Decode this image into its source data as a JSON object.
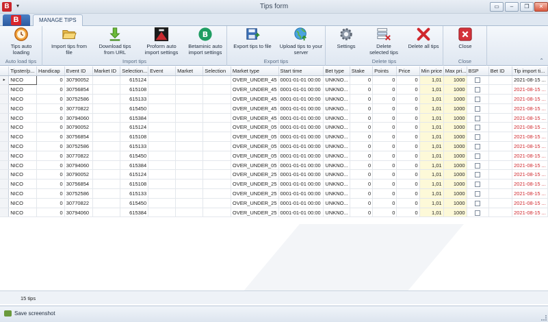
{
  "window": {
    "title": "Tips form",
    "app_badge": "B",
    "min_icon": "minimize-icon",
    "restore_icon": "restore-icon",
    "close_icon": "close-icon"
  },
  "ribbon": {
    "app_button_badge": "B",
    "tab": "MANAGE TIPS",
    "groups": [
      {
        "label": "Auto load tips",
        "buttons": [
          {
            "label": "Tips auto loading",
            "icon": "clock-icon"
          }
        ]
      },
      {
        "label": "Import tips",
        "buttons": [
          {
            "label": "Import tips from file",
            "icon": "folder-open-icon"
          },
          {
            "label": "Download tips from URL",
            "icon": "download-arrow-icon"
          },
          {
            "label": "Proform auto import settings",
            "icon": "proform-logo-icon"
          },
          {
            "label": "Betaminic auto import settings",
            "icon": "betaminic-logo-icon"
          }
        ]
      },
      {
        "label": "Export tips",
        "buttons": [
          {
            "label": "Export tips to file",
            "icon": "save-export-icon"
          },
          {
            "label": "Upload tips to your server",
            "icon": "globe-upload-icon"
          }
        ]
      },
      {
        "label": "Delete tips",
        "buttons": [
          {
            "label": "Settings",
            "icon": "gear-icon"
          },
          {
            "label": "Delete selected tips",
            "icon": "delete-selected-icon"
          },
          {
            "label": "Delete all tips",
            "icon": "red-x-icon"
          }
        ]
      },
      {
        "label": "Close",
        "buttons": [
          {
            "label": "Close",
            "icon": "close-red-icon"
          }
        ]
      }
    ]
  },
  "grid": {
    "columns": [
      "Tipster/p...",
      "Handicap",
      "Event ID",
      "Market ID",
      "Selection...",
      "Event",
      "Market",
      "Selection",
      "Market type",
      "Start time",
      "Bet type",
      "Stake",
      "Points",
      "Price",
      "Min price",
      "Max pri...",
      "BSP",
      "Bet ID",
      "Tip import ti..."
    ],
    "rows": [
      [
        "NICO",
        "0",
        "30790052",
        "",
        "615124",
        "",
        "",
        "",
        "OVER_UNDER_45",
        "0001-01-01 00:00",
        "UNKNO...",
        "0",
        "0",
        "0",
        "1,01",
        "1000",
        "",
        "",
        "2021-08-15 ..."
      ],
      [
        "NICO",
        "0",
        "30756854",
        "",
        "615108",
        "",
        "",
        "",
        "OVER_UNDER_45",
        "0001-01-01 00:00",
        "UNKNO...",
        "0",
        "0",
        "0",
        "1,01",
        "1000",
        "",
        "",
        "2021-08-15 ..."
      ],
      [
        "NICO",
        "0",
        "30752586",
        "",
        "615133",
        "",
        "",
        "",
        "OVER_UNDER_45",
        "0001-01-01 00:00",
        "UNKNO...",
        "0",
        "0",
        "0",
        "1,01",
        "1000",
        "",
        "",
        "2021-08-15 ..."
      ],
      [
        "NICO",
        "0",
        "30770822",
        "",
        "615450",
        "",
        "",
        "",
        "OVER_UNDER_45",
        "0001-01-01 00:00",
        "UNKNO...",
        "0",
        "0",
        "0",
        "1,01",
        "1000",
        "",
        "",
        "2021-08-15 ..."
      ],
      [
        "NICO",
        "0",
        "30794060",
        "",
        "615384",
        "",
        "",
        "",
        "OVER_UNDER_45",
        "0001-01-01 00:00",
        "UNKNO...",
        "0",
        "0",
        "0",
        "1,01",
        "1000",
        "",
        "",
        "2021-08-15 ..."
      ],
      [
        "NICO",
        "0",
        "30790052",
        "",
        "615124",
        "",
        "",
        "",
        "OVER_UNDER_05",
        "0001-01-01 00:00",
        "UNKNO...",
        "0",
        "0",
        "0",
        "1,01",
        "1000",
        "",
        "",
        "2021-08-15 ..."
      ],
      [
        "NICO",
        "0",
        "30756854",
        "",
        "615108",
        "",
        "",
        "",
        "OVER_UNDER_05",
        "0001-01-01 00:00",
        "UNKNO...",
        "0",
        "0",
        "0",
        "1,01",
        "1000",
        "",
        "",
        "2021-08-15 ..."
      ],
      [
        "NICO",
        "0",
        "30752586",
        "",
        "615133",
        "",
        "",
        "",
        "OVER_UNDER_05",
        "0001-01-01 00:00",
        "UNKNO...",
        "0",
        "0",
        "0",
        "1,01",
        "1000",
        "",
        "",
        "2021-08-15 ..."
      ],
      [
        "NICO",
        "0",
        "30770822",
        "",
        "615450",
        "",
        "",
        "",
        "OVER_UNDER_05",
        "0001-01-01 00:00",
        "UNKNO...",
        "0",
        "0",
        "0",
        "1,01",
        "1000",
        "",
        "",
        "2021-08-15 ..."
      ],
      [
        "NICO",
        "0",
        "30794060",
        "",
        "615384",
        "",
        "",
        "",
        "OVER_UNDER_05",
        "0001-01-01 00:00",
        "UNKNO...",
        "0",
        "0",
        "0",
        "1,01",
        "1000",
        "",
        "",
        "2021-08-15 ..."
      ],
      [
        "NICO",
        "0",
        "30790052",
        "",
        "615124",
        "",
        "",
        "",
        "OVER_UNDER_25",
        "0001-01-01 00:00",
        "UNKNO...",
        "0",
        "0",
        "0",
        "1,01",
        "1000",
        "",
        "",
        "2021-08-15 ..."
      ],
      [
        "NICO",
        "0",
        "30756854",
        "",
        "615108",
        "",
        "",
        "",
        "OVER_UNDER_25",
        "0001-01-01 00:00",
        "UNKNO...",
        "0",
        "0",
        "0",
        "1,01",
        "1000",
        "",
        "",
        "2021-08-15 ..."
      ],
      [
        "NICO",
        "0",
        "30752586",
        "",
        "615133",
        "",
        "",
        "",
        "OVER_UNDER_25",
        "0001-01-01 00:00",
        "UNKNO...",
        "0",
        "0",
        "0",
        "1,01",
        "1000",
        "",
        "",
        "2021-08-15 ..."
      ],
      [
        "NICO",
        "0",
        "30770822",
        "",
        "615450",
        "",
        "",
        "",
        "OVER_UNDER_25",
        "0001-01-01 00:00",
        "UNKNO...",
        "0",
        "0",
        "0",
        "1,01",
        "1000",
        "",
        "",
        "2021-08-15 ..."
      ],
      [
        "NICO",
        "0",
        "30794060",
        "",
        "615384",
        "",
        "",
        "",
        "OVER_UNDER_25",
        "0001-01-01 00:00",
        "UNKNO...",
        "0",
        "0",
        "0",
        "1,01",
        "1000",
        "",
        "",
        "2021-08-15 ..."
      ]
    ],
    "selected_row": 0,
    "row_indicator": "▸",
    "import_time_colors": [
      "dark",
      "red",
      "red",
      "red",
      "red",
      "red",
      "red",
      "red",
      "red",
      "red",
      "red",
      "red",
      "red",
      "red",
      "red"
    ],
    "accent_red": "#d0282e",
    "highlight_yellow": "#fdf9d8"
  },
  "footer": {
    "tips_count": "15 tips"
  },
  "statusbar": {
    "save_label": "Save screenshot",
    "save_icon": "camera-icon"
  }
}
